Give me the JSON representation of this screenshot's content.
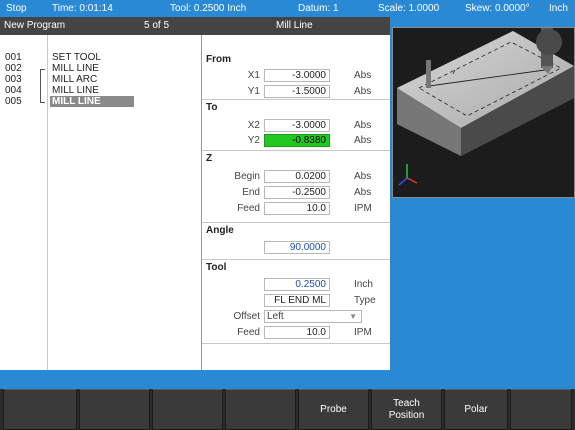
{
  "status": {
    "state": "Stop",
    "time": "Time: 0:01:14",
    "tool": "Tool: 0.2500 Inch",
    "datum": "Datum: 1",
    "scale": "Scale: 1.0000",
    "skew": "Skew: 0.0000°",
    "units": "Inch"
  },
  "title": {
    "program": "New Program",
    "position": "5 of 5",
    "operation": "Mill Line"
  },
  "program_list": [
    {
      "num": "001",
      "name": "SET TOOL"
    },
    {
      "num": "002",
      "name": "MILL LINE"
    },
    {
      "num": "003",
      "name": "MILL ARC"
    },
    {
      "num": "004",
      "name": "MILL LINE"
    },
    {
      "num": "005",
      "name": "MILL LINE"
    }
  ],
  "form": {
    "from": {
      "title": "From",
      "x1_label": "X1",
      "x1_value": "-3.0000",
      "x1_unit": "Abs",
      "y1_label": "Y1",
      "y1_value": "-1.5000",
      "y1_unit": "Abs"
    },
    "to": {
      "title": "To",
      "x2_label": "X2",
      "x2_value": "-3.0000",
      "x2_unit": "Abs",
      "y2_label": "Y2",
      "y2_value": "-0.8380",
      "y2_unit": "Abs"
    },
    "z": {
      "title": "Z",
      "begin_label": "Begin",
      "begin_value": "0.0200",
      "begin_unit": "Abs",
      "end_label": "End",
      "end_value": "-0.2500",
      "end_unit": "Abs",
      "feed_label": "Feed",
      "feed_value": "10.0",
      "feed_unit": "IPM"
    },
    "angle": {
      "title": "Angle",
      "value": "90.0000"
    },
    "tool": {
      "title": "Tool",
      "size_value": "0.2500",
      "size_unit": "Inch",
      "type_value": "FL END ML",
      "type_unit": "Type",
      "offset_label": "Offset",
      "offset_value": "Left",
      "feed_label": "Feed",
      "feed_value": "10.0",
      "feed_unit": "IPM"
    }
  },
  "softkeys": [
    "",
    "",
    "",
    "",
    "Probe",
    "Teach Position",
    "Polar",
    ""
  ],
  "colors": {
    "background": "#2a89d5",
    "title_bar": "#444444",
    "active_field": "#22c722",
    "softkey": "#3a3a3a"
  }
}
